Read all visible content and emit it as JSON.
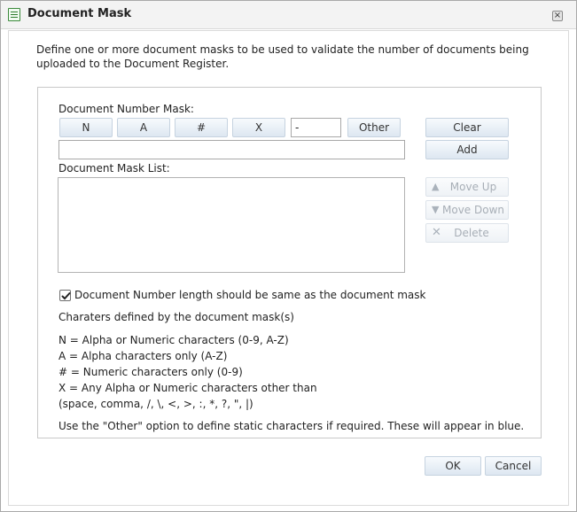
{
  "dialog": {
    "title": "Document Mask",
    "close_glyph": "×",
    "intro_line1": "Define one or more document masks to be used to validate the number of documents being",
    "intro_line2": "uploaded to the Document Register."
  },
  "mask": {
    "number_mask_label": "Document Number Mask:",
    "buttons": {
      "n": "N",
      "a": "A",
      "hash": "#",
      "x": "X",
      "other": "Other"
    },
    "separator_value": "-",
    "mask_input_value": "",
    "list_label": "Document Mask List:",
    "list_items": []
  },
  "actions": {
    "clear": "Clear",
    "add": "Add",
    "move_up": "Move Up",
    "move_down": "Move Down",
    "delete": "Delete"
  },
  "options": {
    "same_length_checked": true,
    "same_length_label": "Document Number length should be same as the document mask"
  },
  "legend": {
    "heading": "Charaters defined by the document mask(s)",
    "n_line": "N = Alpha or Numeric characters (0-9, A-Z)",
    "a_line": "A = Alpha characters only (A-Z)",
    "hash_line": "# = Numeric characters only (0-9)",
    "x_line": "X = Any Alpha or Numeric characters other than",
    "x_exclusions": "(space, comma, /, \\, <, >, :, *, ?, \", |)",
    "other_note": "Use the \"Other\" option to define static characters if required. These will appear in blue."
  },
  "footer": {
    "ok": "OK",
    "cancel": "Cancel"
  },
  "icons": {
    "title": "list-document-icon",
    "move_up": "arrow-up-icon",
    "move_down": "arrow-down-icon",
    "delete": "x-delete-icon"
  },
  "colors": {
    "button_border": "#c6d3e0",
    "button_top": "#f7fafd",
    "button_bottom": "#dde7f1",
    "disabled_text": "#a7aeb6",
    "title_icon_green": "#2f7d2f"
  }
}
